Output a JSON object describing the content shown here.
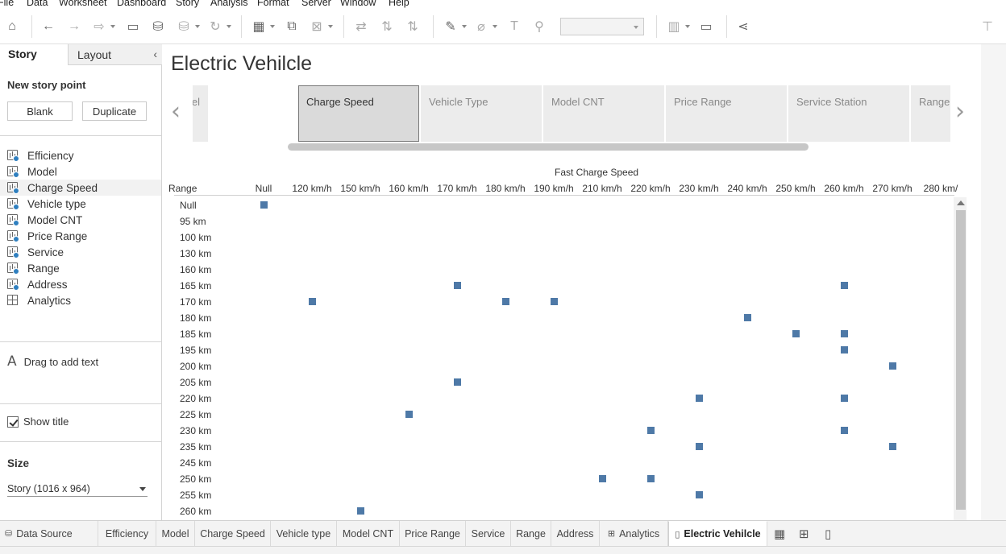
{
  "menu": [
    "File",
    "Data",
    "Worksheet",
    "Dashboard",
    "Story",
    "Analysis",
    "Format",
    "Server",
    "Window",
    "Help"
  ],
  "left_pane": {
    "tabs": {
      "story": "Story",
      "layout": "Layout"
    },
    "new_story_point": "New story point",
    "blank_button": "Blank",
    "duplicate_button": "Duplicate",
    "sheets": [
      {
        "label": "Efficiency",
        "icon": "worksheet-icon"
      },
      {
        "label": "Model",
        "icon": "worksheet-icon"
      },
      {
        "label": "Charge Speed",
        "icon": "worksheet-icon",
        "active": true
      },
      {
        "label": "Vehicle type",
        "icon": "worksheet-icon"
      },
      {
        "label": "Model CNT",
        "icon": "worksheet-icon"
      },
      {
        "label": "Price Range",
        "icon": "worksheet-icon"
      },
      {
        "label": "Service",
        "icon": "worksheet-icon"
      },
      {
        "label": "Range",
        "icon": "worksheet-icon"
      },
      {
        "label": "Address",
        "icon": "worksheet-icon"
      },
      {
        "label": "Analytics",
        "icon": "dashboard-icon"
      }
    ],
    "drag_text": "Drag to add text",
    "show_title": "Show title",
    "show_title_checked": true,
    "size_title": "Size",
    "size_value": "Story (1016 x 964)"
  },
  "story": {
    "title": "Electric Vehilcle",
    "points": [
      "odel",
      "Charge Speed",
      "Vehicle Type",
      "Model CNT",
      "Price Range",
      "Service Station",
      "Range"
    ],
    "active_point": 1
  },
  "viz": {
    "column_header_title": "Fast Charge Speed",
    "row_header_title": "Range",
    "columns": [
      "Null",
      "120 km/h",
      "150 km/h",
      "160 km/h",
      "170 km/h",
      "180 km/h",
      "190 km/h",
      "210 km/h",
      "220 km/h",
      "230 km/h",
      "240 km/h",
      "250 km/h",
      "260 km/h",
      "270 km/h",
      "280 km/"
    ],
    "rows": [
      "Null",
      "95 km",
      "100 km",
      "130 km",
      "160 km",
      "165 km",
      "170 km",
      "180 km",
      "185 km",
      "195 km",
      "200 km",
      "205 km",
      "220 km",
      "225 km",
      "230 km",
      "235 km",
      "245 km",
      "250 km",
      "255 km",
      "260 km"
    ],
    "marks": [
      [
        "Null",
        "Null"
      ],
      [
        "165 km",
        "170 km/h"
      ],
      [
        "165 km",
        "260 km/h"
      ],
      [
        "170 km",
        "120 km/h"
      ],
      [
        "170 km",
        "180 km/h"
      ],
      [
        "170 km",
        "190 km/h"
      ],
      [
        "180 km",
        "240 km/h"
      ],
      [
        "185 km",
        "250 km/h"
      ],
      [
        "185 km",
        "260 km/h"
      ],
      [
        "195 km",
        "260 km/h"
      ],
      [
        "200 km",
        "270 km/h"
      ],
      [
        "205 km",
        "170 km/h"
      ],
      [
        "220 km",
        "230 km/h"
      ],
      [
        "220 km",
        "260 km/h"
      ],
      [
        "225 km",
        "160 km/h"
      ],
      [
        "230 km",
        "220 km/h"
      ],
      [
        "230 km",
        "260 km/h"
      ],
      [
        "235 km",
        "230 km/h"
      ],
      [
        "235 km",
        "270 km/h"
      ],
      [
        "250 km",
        "210 km/h"
      ],
      [
        "250 km",
        "220 km/h"
      ],
      [
        "255 km",
        "230 km/h"
      ],
      [
        "260 km",
        "150 km/h"
      ]
    ],
    "mark_color": "#4e79a7"
  },
  "bottom_tabs": [
    {
      "label": "Data Source",
      "icon": "database-icon"
    },
    {
      "label": "Efficiency"
    },
    {
      "label": "Model"
    },
    {
      "label": "Charge Speed"
    },
    {
      "label": "Vehicle type"
    },
    {
      "label": "Model CNT"
    },
    {
      "label": "Price Range"
    },
    {
      "label": "Service"
    },
    {
      "label": "Range"
    },
    {
      "label": "Address"
    },
    {
      "label": "Analytics",
      "icon": "dashboard-icon"
    },
    {
      "label": "Electric Vehilcle",
      "icon": "story-icon",
      "active": true
    }
  ]
}
